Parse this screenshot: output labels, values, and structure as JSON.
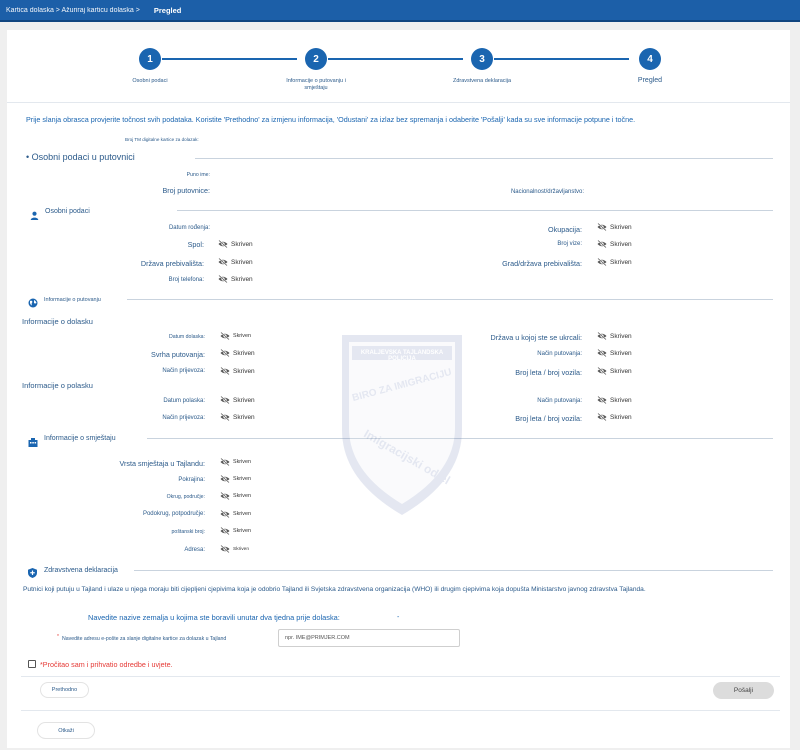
{
  "topbar": {
    "crumbs": "Kartica dolaska > Ažuriraj karticu dolaska >",
    "current": "Pregled"
  },
  "steps": [
    {
      "num": "1",
      "label": "Osobni podaci"
    },
    {
      "num": "2",
      "label": "Informacije o putovanju i smještaju"
    },
    {
      "num": "3",
      "label": "Zdravstvena deklaracija"
    },
    {
      "num": "4",
      "label": "Pregled"
    }
  ],
  "intro": "Prije slanja obrasca provjerite točnost svih podataka. Koristite 'Prethodno' za izmjenu informacija, 'Odustani' za izlaz bez spremanja i odaberite 'Pošalji' kada su sve informacije potpune i točne.",
  "tm_card_label": "Broj TM digitalne kartice za dolazak:",
  "passport_section": {
    "title": "• Osobni podaci u putovnici",
    "full_name_label": "Puno ime:",
    "passport_no_label": "Broj putovnice:",
    "nationality_label": "Nacionalnost/državljanstvo:"
  },
  "hidden": "Skriven",
  "personal": {
    "title": "Osobni podaci",
    "dob_label": "Datum rođenja:",
    "occupation_label": "Okupacija:",
    "gender_label": "Spol:",
    "visa_label": "Broj vize:",
    "country_label": "Država prebivališta:",
    "city_label": "Grad/država prebivališta:",
    "phone_label": "Broj telefona:"
  },
  "travel": {
    "title": "Informacije o putovanju",
    "arrival_title": "Informacije o dolasku",
    "arrival_date_label": "Datum dolaska:",
    "boarded_country_label": "Država u kojoj ste se ukrcali:",
    "purpose_label": "Svrha putovanja:",
    "travel_mode_label": "Način putovanja:",
    "transport_label": "Način prijevoza:",
    "flight_label": "Broj leta / broj vozila:",
    "departure_title": "Informacije o polasku",
    "departure_date_label": "Datum polaska:",
    "dep_travel_mode_label": "Način putovanja:",
    "dep_transport_label": "Način prijevoza:",
    "dep_flight_label": "Broj leta / broj vozila:"
  },
  "accommodation": {
    "title": "Informacije o smještaju",
    "type_label": "Vrsta smještaja u Tajlandu:",
    "province_label": "Pokrajina:",
    "district_label": "Okrug, područje:",
    "subdistrict_label": "Podokrug, potpodručje:",
    "postal_label": "poštanski broj:",
    "address_label": "Adresa:"
  },
  "health": {
    "title": "Zdravstvena deklaracija",
    "text": "Putnici koji putuju u Tajland i ulaze u njega moraju biti cijepljeni cjepivima koja je odobrio Tajland ili Svjetska zdravstvena organizacija (WHO) ili drugim cjepivima koja dopušta Ministarstvo javnog zdravstva Tajlanda.",
    "countries_label": "Navedite nazive zemalja u kojima ste boravili unutar dva tjedna prije dolaska:",
    "countries_value": "-",
    "email_label": "Navedite adresu e-pošte za slanje digitalne kartice za dolazak u Tajland",
    "email_placeholder": "npr. IME@PRIMJER.COM"
  },
  "consent": "*Pročitao sam i prihvatio odredbe i uvjete.",
  "buttons": {
    "previous": "Prethodno",
    "submit": "Pošalji",
    "cancel": "Otkaži"
  },
  "watermark": {
    "top": "KRALJEVSKA TAJLANDSKA POLICIJA",
    "middle": "BIRO ZA IMIGRACIJU",
    "bottom": "Imigracijski odjel"
  },
  "colors": {
    "primary": "#1a65b0",
    "topbar": "#1c5fa8",
    "error": "#e53935"
  }
}
